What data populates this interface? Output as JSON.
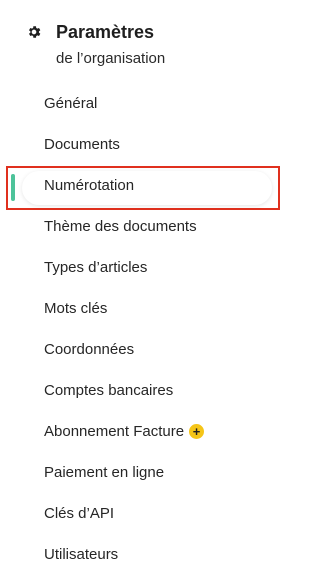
{
  "header": {
    "title": "Paramètres",
    "subtitle": "de l’organisation",
    "icon": "gear-icon"
  },
  "nav": {
    "items": [
      {
        "label": "Général",
        "active": false
      },
      {
        "label": "Documents",
        "active": false
      },
      {
        "label": "Numérotation",
        "active": true
      },
      {
        "label": "Thème des documents",
        "active": false
      },
      {
        "label": "Types d’articles",
        "active": false
      },
      {
        "label": "Mots clés",
        "active": false
      },
      {
        "label": "Coordonnées",
        "active": false
      },
      {
        "label": "Comptes bancaires",
        "active": false
      },
      {
        "label": "Abonnement Facture",
        "active": false,
        "badge_symbol": "+"
      },
      {
        "label": "Paiement en ligne",
        "active": false
      },
      {
        "label": "Clés d’API",
        "active": false
      },
      {
        "label": "Utilisateurs",
        "active": false
      }
    ]
  },
  "colors": {
    "active_indicator": "#4dc39a",
    "focus_outline": "#e0301e",
    "badge": "#f5c518"
  }
}
